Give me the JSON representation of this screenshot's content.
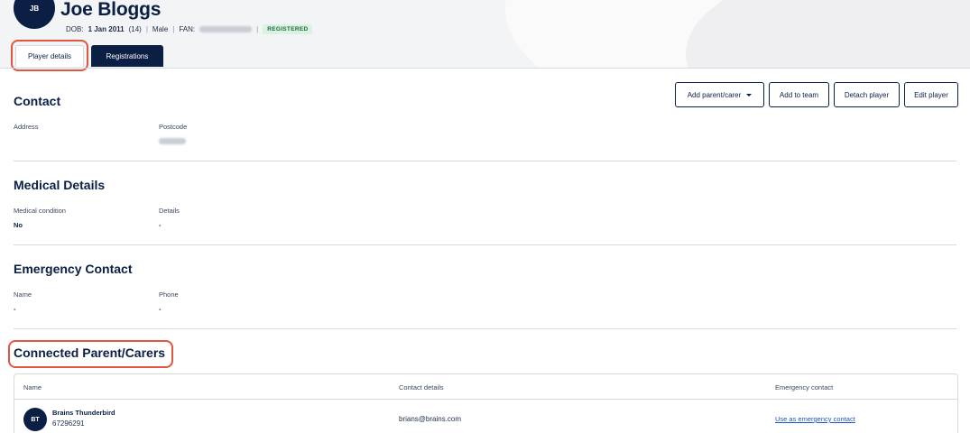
{
  "player": {
    "initials": "JB",
    "name": "Joe Bloggs",
    "dob_label": "DOB:",
    "dob_value": "1 Jan 2011",
    "age": "(14)",
    "gender": "Male",
    "fan_label": "FAN:",
    "status_badge": "REGISTERED"
  },
  "tabs": [
    {
      "label": "Player details"
    },
    {
      "label": "Registrations"
    }
  ],
  "actions": {
    "add_parent": "Add parent/carer",
    "add_team": "Add to team",
    "detach": "Detach player",
    "edit": "Edit player"
  },
  "contact": {
    "title": "Contact",
    "address_label": "Address",
    "postcode_label": "Postcode"
  },
  "medical": {
    "title": "Medical Details",
    "condition_label": "Medical condition",
    "condition_value": "No",
    "details_label": "Details",
    "details_value": "-"
  },
  "emergency": {
    "title": "Emergency Contact",
    "name_label": "Name",
    "name_value": "-",
    "phone_label": "Phone",
    "phone_value": "-"
  },
  "connected": {
    "title": "Connected Parent/Carers",
    "columns": [
      "Name",
      "Contact details",
      "Emergency contact"
    ],
    "rows": [
      {
        "initials": "BT",
        "name": "Brains Thunderbird",
        "id": "67296291",
        "email": "brians@brains.com",
        "action": "Use as emergency contact"
      }
    ]
  },
  "colors": {
    "navy": "#0b1f45",
    "highlight": "#e0563f",
    "badge_bg": "#d9f2e2",
    "link": "#1a56c4"
  }
}
